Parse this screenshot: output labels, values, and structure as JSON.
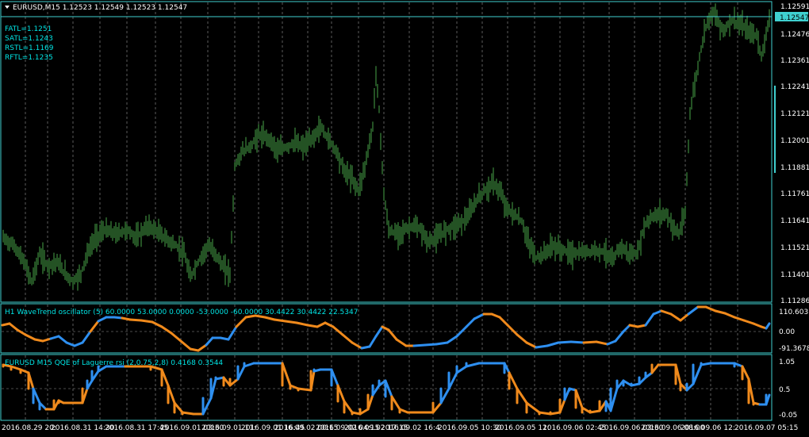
{
  "main_title": "EURUSD,M15  1.12523 1.12549 1.12523 1.12547",
  "labels": [
    "FATL=1.1251",
    "SATL=1.1243",
    "RSTL=1.1169",
    "RFTL=1.1235"
  ],
  "price_axis": [
    "1.12591",
    "1.12476",
    "1.12361",
    "1.12241",
    "1.12121",
    "1.12001",
    "1.11881",
    "1.11761",
    "1.11641",
    "1.11521",
    "1.11401",
    "1.11286"
  ],
  "current_price": "1.12547",
  "wt_title": "H1 WaveTrend oscillator (5) 60.0000 53.0000 0.0000 -53.0000 -60.0000 30.4422 30.4422 22.5347",
  "wt_axis": [
    "110.6031",
    "0.00",
    "-91.3678"
  ],
  "qqe_title": "EURUSD M15 QQE of Laguerre rsi (2,0.75,2,8) 0.4168 0.3544",
  "qqe_axis": [
    "1.05",
    "0.5",
    "-0.05"
  ],
  "time_axis": [
    "2016.08.29 20:",
    "2016.08.31 14:30",
    "2016.08.31 17:45",
    "2016.09.01 03:30",
    "2016.09.01 11:",
    "2016.09.01 16:45",
    "2016.09.02 00:15",
    "2016.09.02 04:15",
    "2016.09.02 17:15",
    "2016.09.02 16:4",
    "2016.09.05 10:30",
    "2016.09.05 11:",
    "2016.09.06 02:45",
    "2016.09.06 03:30",
    "2016.09.06 08:00",
    "2016.09.06 12:",
    "2016.09.07 05:15"
  ],
  "colors": {
    "candle": "#48a548",
    "panel_border": "#3fd0d0",
    "grid": "#9a9a9a",
    "wt_up": "#2e8ff0",
    "wt_down": "#f08a1c",
    "bg": "#000000"
  }
}
